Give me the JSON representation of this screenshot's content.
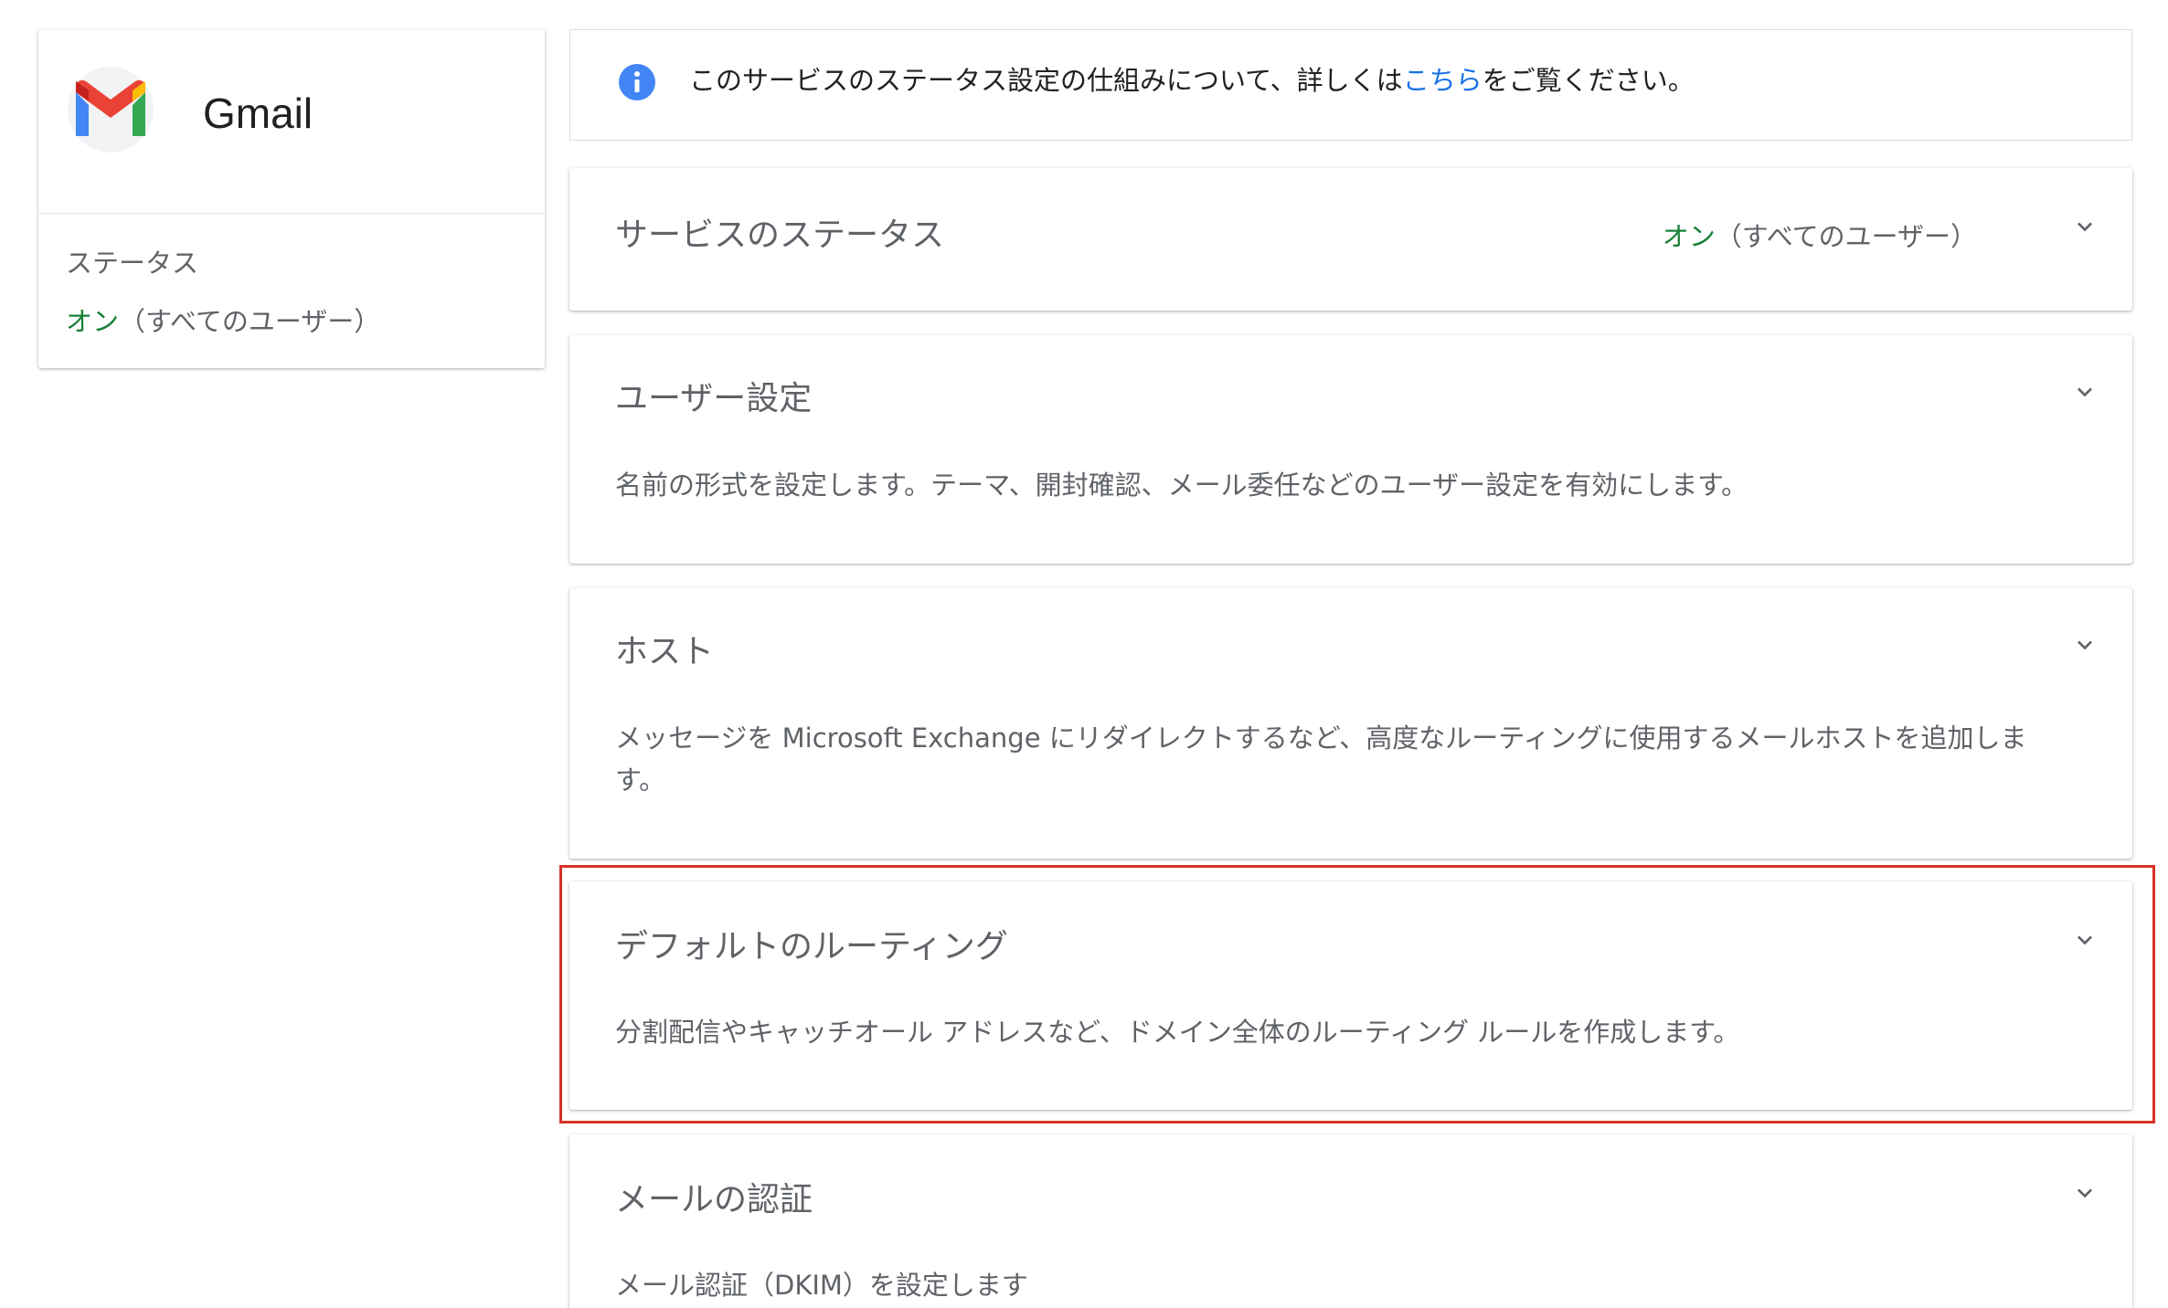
{
  "service": {
    "name": "Gmail",
    "status_label": "ステータス",
    "status_on": "オン",
    "status_scope": "（すべてのユーザー）"
  },
  "info": {
    "text_before": "このサービスのステータス設定の仕組みについて、詳しくは",
    "link": "こちら",
    "text_after": "をご覧ください。"
  },
  "sections": [
    {
      "title": "サービスのステータス",
      "status_on": "オン",
      "status_scope": "（すべてのユーザー）"
    },
    {
      "title": "ユーザー設定",
      "description": "名前の形式を設定します。テーマ、開封確認、メール委任などのユーザー設定を有効にします。"
    },
    {
      "title": "ホスト",
      "description": "メッセージを Microsoft Exchange にリダイレクトするなど、高度なルーティングに使用するメールホストを追加します。"
    },
    {
      "title": "デフォルトのルーティング",
      "description": "分割配信やキャッチオール アドレスなど、ドメイン全体のルーティング ルールを作成します。"
    },
    {
      "title": "メールの認証",
      "description": "メール認証（DKIM）を設定します"
    }
  ],
  "colors": {
    "accent_link": "#1a73e8",
    "status_on": "#188038",
    "highlight_border": "#d93025",
    "info_icon": "#4285f4"
  },
  "icons": {
    "logo": "gmail-logo",
    "info": "info-icon",
    "chevron": "chevron-down-icon"
  }
}
